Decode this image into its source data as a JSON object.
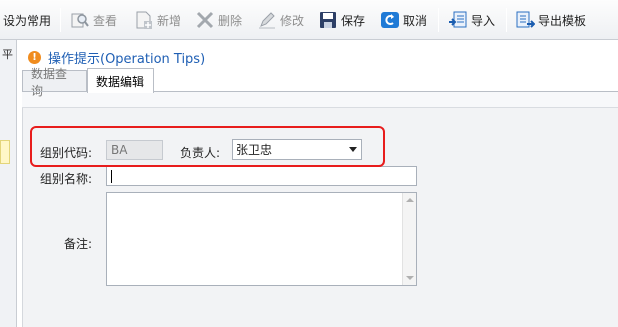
{
  "toolbar": {
    "set_default": "设为常用",
    "view": "查看",
    "add": "新增",
    "delete": "删除",
    "modify": "修改",
    "save": "保存",
    "cancel": "取消",
    "import": "导入",
    "export_template": "导出模板"
  },
  "left_strip": {
    "label": "平"
  },
  "tips": {
    "icon": "!",
    "text": "操作提示(Operation Tips)"
  },
  "tabs": {
    "query": "数据查询",
    "edit": "数据编辑"
  },
  "form": {
    "group_code_label": "组别代码:",
    "group_code_value": "BA",
    "owner_label": "负责人:",
    "owner_value": "张卫忠",
    "group_name_label": "组别名称:",
    "group_name_value": "",
    "remark_label": "备注:",
    "remark_value": ""
  },
  "colors": {
    "highlight": "#e81c1c",
    "tips_text": "#1f5fb4",
    "warn_icon": "#f08c1e"
  }
}
